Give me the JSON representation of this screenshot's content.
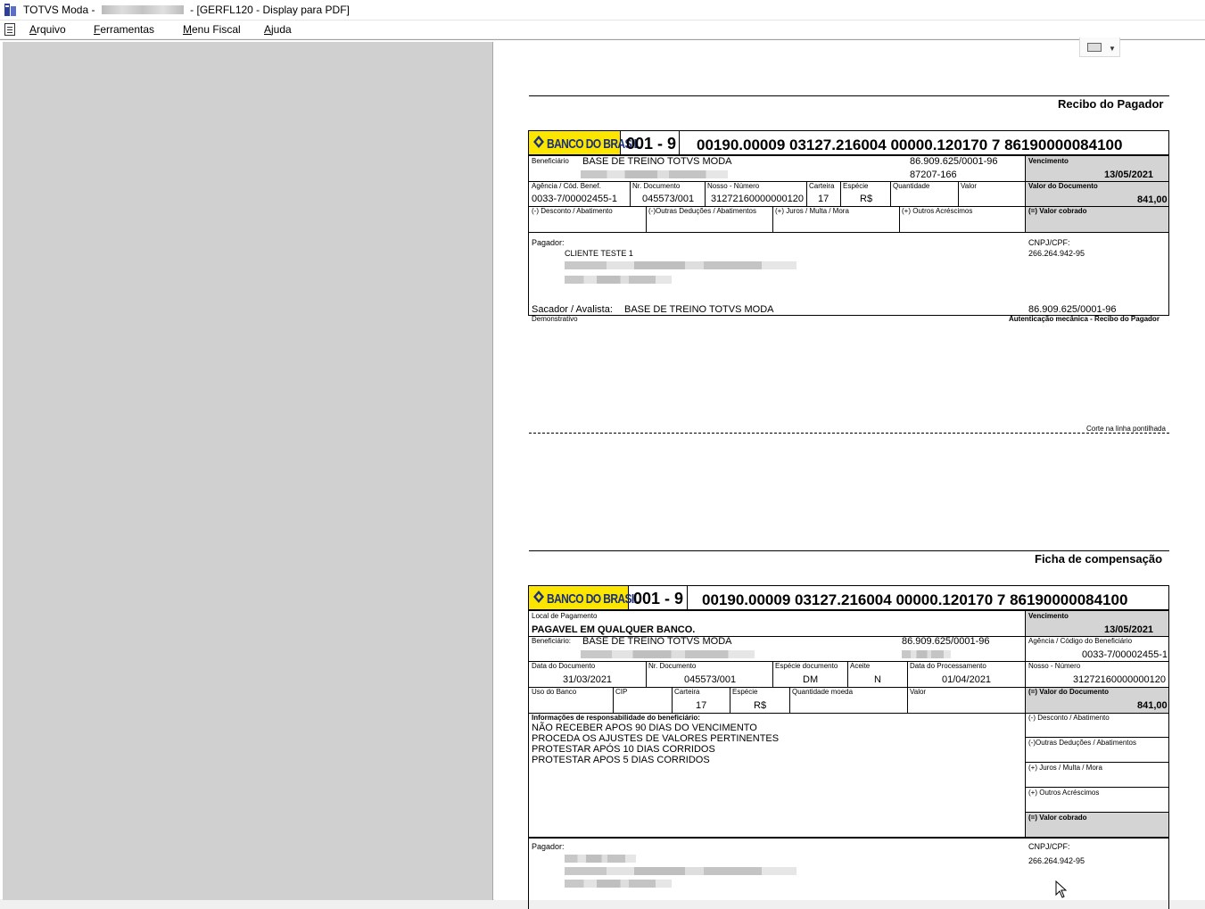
{
  "window": {
    "title_prefix": "TOTVS Moda -",
    "title_suffix": "- [GERFL120 - Display para PDF]"
  },
  "menu": {
    "items": [
      {
        "u": "A",
        "rest": "rquivo"
      },
      {
        "u": "F",
        "rest": "erramentas"
      },
      {
        "u": "M",
        "rest": "enu Fiscal"
      },
      {
        "u": "A",
        "rest": "juda"
      }
    ]
  },
  "receipt": {
    "title": "Recibo do Pagador",
    "bank_logo": "BANCO DO BRASIL",
    "bank_code": "001 - 9",
    "digitable_line": "00190.00009 03127.216004 00000.120170   7    86190000084100",
    "beneficiario_label": "Beneficiário",
    "beneficiario": "BASE DE TREINO TOTVS MODA",
    "beneficiario_cnpj": "86.909.625/0001-96",
    "beneficiario_cep": "87207-166",
    "vencimento_label": "Vencimento",
    "vencimento": "13/05/2021",
    "agencia_label": "Agência / Cód. Benef.",
    "agencia": "0033-7/00002455-1",
    "nr_doc_label": "Nr. Documento",
    "nr_doc": "045573/001",
    "nosso_label": "Nosso - Número",
    "nosso": "31272160000000120",
    "carteira_label": "Carteira",
    "carteira": "17",
    "especie_label": "Espécie",
    "especie": "R$",
    "quantidade_label": "Quantidade",
    "valor_label": "Valor",
    "valor_doc_label": "Valor do Documento",
    "valor_doc": "841,00",
    "desconto_label": "(-) Desconto / Abatimento",
    "outras_deducoes_label": "(-)Outras Deduções / Abatimentos",
    "juros_label": "(+) Juros / Multa / Mora",
    "acrescimos_label": "(+) Outros Acréscimos",
    "valor_cobrado_label": "(=) Valor cobrado",
    "pagador_label": "Pagador:",
    "pagador": "CLIENTE TESTE 1",
    "cnpj_label": "CNPJ/CPF:",
    "cnpj": "266.264.942-95",
    "sacador_label": "Sacador / Avalista:",
    "sacador": "BASE DE TREINO TOTVS MODA",
    "sacador_cnpj": "86.909.625/0001-96",
    "demonstrativo_label": "Demonstrativo",
    "autenticacao_label": "Autenticação mecânica - Recibo do Pagador",
    "corte_label": "Corte na linha pontilhada"
  },
  "ficha": {
    "title": "Ficha de compensação",
    "bank_logo": "BANCO DO BRASIL",
    "bank_code": "001 - 9",
    "digitable_line": "00190.00009 03127.216004 00000.120170   7    86190000084100",
    "local_label": "Local de Pagamento",
    "local": "PAGAVEL EM QUALQUER BANCO.",
    "vencimento_label": "Vencimento",
    "vencimento": "13/05/2021",
    "beneficiario_label": "Beneficiário:",
    "beneficiario": "BASE DE TREINO TOTVS MODA",
    "beneficiario_cnpj": "86.909.625/0001-96",
    "agencia_label": "Agência / Código do Beneficiário",
    "agencia": "0033-7/00002455-1",
    "data_doc_label": "Data do Documento",
    "data_doc": "31/03/2021",
    "nr_doc_label": "Nr. Documento",
    "nr_doc": "045573/001",
    "especie_doc_label": "Espécie documento",
    "especie_doc": "DM",
    "aceite_label": "Aceite",
    "aceite": "N",
    "data_proc_label": "Data do Processamento",
    "data_proc": "01/04/2021",
    "nosso_label": "Nosso - Número",
    "nosso": "31272160000000120",
    "uso_banco_label": "Uso do Banco",
    "cip_label": "CIP",
    "carteira_label": "Carteira",
    "carteira": "17",
    "especie_label": "Espécie",
    "especie": "R$",
    "qtd_moeda_label": "Quantidade moeda",
    "valor_label": "Valor",
    "valor_doc_label": "(=) Valor do Documento",
    "valor_doc": "841,00",
    "info_label": "Informações de responsabilidade do beneficiário:",
    "info_lines": [
      "NÃO RECEBER APOS 90 DIAS DO VENCIMENTO",
      "PROCEDA OS AJUSTES DE VALORES PERTINENTES",
      "PROTESTAR APÓS 10 DIAS CORRIDOS",
      "PROTESTAR APOS 5 DIAS CORRIDOS"
    ],
    "desconto_label": "(-) Desconto / Abatimento",
    "outras_deducoes_label": "(-)Outras Deduções / Abatimentos",
    "juros_label": "(+) Juros / Multa / Mora",
    "acrescimos_label": "(+) Outros Acréscimos",
    "valor_cobrado_label": "(=) Valor cobrado",
    "pagador_label": "Pagador:",
    "cnpj_label": "CNPJ/CPF:",
    "cnpj": "266.264.942-95"
  }
}
